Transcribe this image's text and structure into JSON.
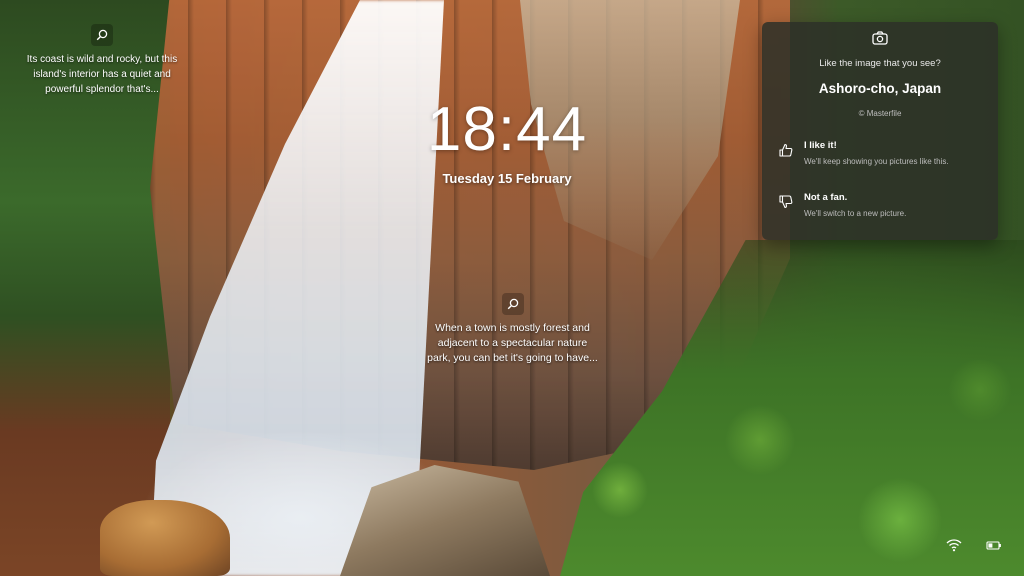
{
  "spotlight": {
    "left_text": "Its coast is wild and rocky, but this island's interior has a quiet and powerful splendor that's...",
    "center_text": "When a town is mostly forest and adjacent to a spectacular nature park, you can bet it's going to have..."
  },
  "lockscreen": {
    "time": "18:44",
    "date": "Tuesday 15 February"
  },
  "flyout": {
    "prompt": "Like the image that you see?",
    "location": "Ashoro-cho, Japan",
    "copyright": "© Masterfile",
    "like": {
      "title": "I like it!",
      "subtitle": "We'll keep showing you pictures like this."
    },
    "dislike": {
      "title": "Not a fan.",
      "subtitle": "We'll switch to a new picture."
    }
  },
  "icons": {
    "search": "search-icon",
    "camera": "camera-icon",
    "like": "thumbs-up-icon",
    "dislike": "thumbs-down-icon",
    "network": "wifi-icon",
    "battery": "battery-icon"
  }
}
